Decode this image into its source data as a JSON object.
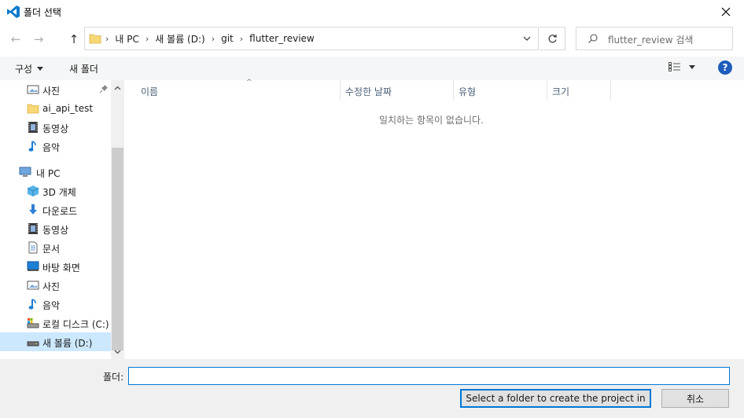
{
  "window": {
    "title": "폴더 선택"
  },
  "nav": {
    "back": "←",
    "forward": "→",
    "up": "↑"
  },
  "address": {
    "crumbs": [
      "내 PC",
      "새 볼륨 (D:)",
      "git",
      "flutter_review"
    ],
    "separator": "›"
  },
  "search": {
    "placeholder": "flutter_review 검색"
  },
  "toolbar": {
    "organize_label": "구성",
    "new_folder_label": "새 폴더",
    "help_label": "?"
  },
  "sidebar": {
    "items": [
      {
        "label": "사진",
        "icon": "pictures-icon",
        "pinned": true
      },
      {
        "label": "ai_api_test",
        "icon": "folder-icon"
      },
      {
        "label": "동영상",
        "icon": "videos-icon"
      },
      {
        "label": "음악",
        "icon": "music-icon"
      },
      {
        "label": "내 PC",
        "icon": "this-pc-icon"
      },
      {
        "label": "3D 개체",
        "icon": "3d-objects-icon"
      },
      {
        "label": "다운로드",
        "icon": "downloads-icon"
      },
      {
        "label": "동영상",
        "icon": "videos-icon"
      },
      {
        "label": "문서",
        "icon": "documents-icon"
      },
      {
        "label": "바탕 화면",
        "icon": "desktop-icon"
      },
      {
        "label": "사진",
        "icon": "pictures-icon"
      },
      {
        "label": "음악",
        "icon": "music-icon"
      },
      {
        "label": "로컬 디스크 (C:)",
        "icon": "local-disk-icon"
      },
      {
        "label": "새 볼륨 (D:)",
        "icon": "drive-icon",
        "selected": true
      }
    ]
  },
  "columns": [
    {
      "label": "이름"
    },
    {
      "label": "수정한 날짜"
    },
    {
      "label": "유형"
    },
    {
      "label": "크기"
    }
  ],
  "content": {
    "empty_message": "일치하는 항목이 없습니다."
  },
  "footer": {
    "folder_label": "폴더:",
    "folder_value": "",
    "select_button": "Select a folder to create the project in",
    "cancel_button": "취소"
  },
  "colors": {
    "accent": "#0078d7",
    "selected_bg": "#cce8ff",
    "folder_yellow": "#f8d775",
    "help_blue": "#1e5dbb"
  }
}
